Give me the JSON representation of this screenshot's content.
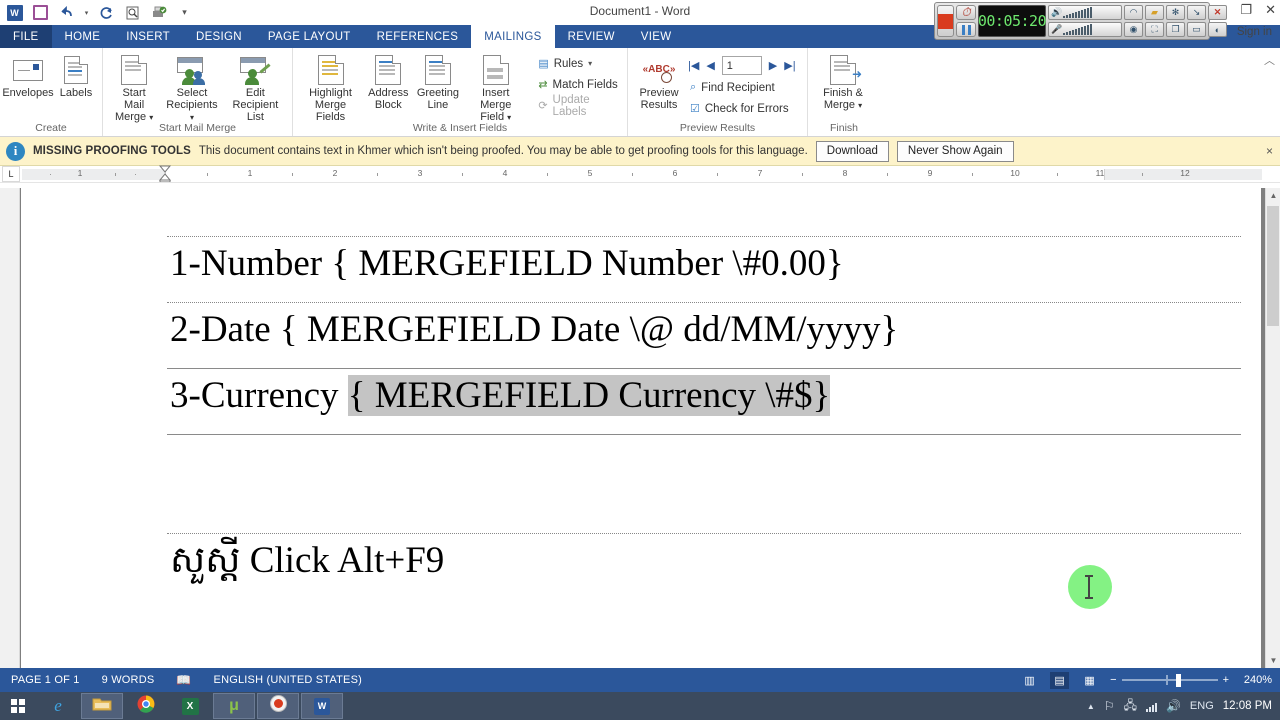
{
  "window": {
    "title": "Document1 - Word",
    "signin": "Sign in",
    "restore_icon": "restore-icon",
    "close_icon": "close-icon"
  },
  "quick_access": {
    "items": [
      {
        "name": "word-logo",
        "glyph": "W"
      },
      {
        "name": "save-icon",
        "glyph": ""
      },
      {
        "name": "undo-icon",
        "glyph": "↶"
      },
      {
        "name": "redo-icon",
        "glyph": "↻"
      },
      {
        "name": "print-preview-icon",
        "glyph": ""
      },
      {
        "name": "quick-print-icon",
        "glyph": ""
      },
      {
        "name": "customize-qat-icon",
        "glyph": "▾"
      }
    ]
  },
  "recorder": {
    "timer": "00:05:20",
    "stop_label": "stop-recording",
    "pause_label": "pause-recording",
    "clock_label": "timer",
    "icons": [
      "wifi-icon",
      "folder-icon",
      "settings-icon",
      "minimize-icon",
      "close-icon",
      "webcam-icon",
      "region-icon",
      "window-icon",
      "fullscreen-icon",
      "screen-icon"
    ]
  },
  "ribbon": {
    "tabs": [
      {
        "label": "FILE",
        "active": false,
        "file": true
      },
      {
        "label": "HOME",
        "active": false
      },
      {
        "label": "INSERT",
        "active": false
      },
      {
        "label": "DESIGN",
        "active": false
      },
      {
        "label": "PAGE LAYOUT",
        "active": false
      },
      {
        "label": "REFERENCES",
        "active": false
      },
      {
        "label": "MAILINGS",
        "active": true
      },
      {
        "label": "REVIEW",
        "active": false
      },
      {
        "label": "VIEW",
        "active": false
      }
    ],
    "groups": {
      "create": {
        "name": "Create",
        "envelopes": "Envelopes",
        "labels": "Labels"
      },
      "start_mail_merge": {
        "name": "Start Mail Merge",
        "start_mail_merge": "Start Mail\nMerge",
        "start_mail_merge_l1": "Start Mail",
        "start_mail_merge_l2": "Merge",
        "select_recipients_l1": "Select",
        "select_recipients_l2": "Recipients",
        "edit_recipient_l1": "Edit",
        "edit_recipient_l2": "Recipient List"
      },
      "write_insert": {
        "name": "Write & Insert Fields",
        "highlight_l1": "Highlight",
        "highlight_l2": "Merge Fields",
        "address_l1": "Address",
        "address_l2": "Block",
        "greeting_l1": "Greeting",
        "greeting_l2": "Line",
        "insert_merge_l1": "Insert Merge",
        "insert_merge_l2": "Field",
        "rules": "Rules",
        "match_fields": "Match Fields",
        "update_labels": "Update Labels"
      },
      "preview_results": {
        "name": "Preview Results",
        "preview_l1": "Preview",
        "preview_l2": "Results",
        "record_number": "1",
        "first": "first-record",
        "prev": "previous-record",
        "next": "next-record",
        "last": "last-record",
        "find_recipient": "Find Recipient",
        "check_errors": "Check for Errors"
      },
      "finish": {
        "name": "Finish",
        "finish_merge_l1": "Finish &",
        "finish_merge_l2": "Merge"
      }
    }
  },
  "message_bar": {
    "title": "MISSING PROOFING TOOLS",
    "text": "This document contains text in Khmer which isn't being proofed. You may be able to get proofing tools for this language.",
    "download": "Download",
    "never_show": "Never Show Again",
    "close": "×"
  },
  "ruler": {
    "tab_selector": "L",
    "numbers_left": [
      "1"
    ],
    "numbers_right": [
      "1",
      "2",
      "3",
      "4",
      "5",
      "6",
      "7",
      "8",
      "9",
      "10",
      "11",
      "12"
    ]
  },
  "document": {
    "lines": [
      {
        "prefix": "1-Number ",
        "field": "{ MERGEFIELD Number \\#0.00}",
        "selected": false
      },
      {
        "prefix": "2-Date ",
        "field": "{ MERGEFIELD Date \\@ dd/MM/yyyy}",
        "selected": false
      },
      {
        "prefix": "3-Currency ",
        "field": "{ MERGEFIELD Currency \\#$}",
        "selected": true
      },
      {
        "prefix": "",
        "field": "",
        "selected": false
      },
      {
        "prefix": "សួស្ដី Click Alt+F9",
        "field": "",
        "selected": false
      }
    ]
  },
  "status_bar": {
    "page": "PAGE 1 OF 1",
    "words": "9 WORDS",
    "proof_icon": "proofing-icon",
    "language": "ENGLISH (UNITED STATES)",
    "views": [
      {
        "name": "read-mode-icon",
        "glyph": "▥",
        "active": false
      },
      {
        "name": "print-layout-icon",
        "glyph": "▤",
        "active": true
      },
      {
        "name": "web-layout-icon",
        "glyph": "▦",
        "active": false
      }
    ],
    "zoom_out": "−",
    "zoom_in": "+",
    "zoom_level": "240%"
  },
  "taskbar": {
    "start": "start-button",
    "apps": [
      {
        "name": "internet-explorer-icon",
        "glyph": "e",
        "active": false
      },
      {
        "name": "file-explorer-icon",
        "glyph": "",
        "active": true
      },
      {
        "name": "chrome-icon",
        "glyph": "",
        "active": false
      },
      {
        "name": "excel-icon",
        "glyph": "X",
        "active": false
      },
      {
        "name": "utorrent-icon",
        "glyph": "μ",
        "active": true
      },
      {
        "name": "screen-recorder-icon",
        "glyph": "●",
        "active": true
      },
      {
        "name": "word-icon",
        "glyph": "W",
        "active": true
      }
    ],
    "tray": {
      "show_hidden": "▲",
      "flag_icon": "action-center-icon",
      "network_icon": "network-icon",
      "signal_icon": "signal-icon",
      "volume_icon": "volume-icon",
      "language": "ENG",
      "clock": "12:08 PM"
    }
  }
}
